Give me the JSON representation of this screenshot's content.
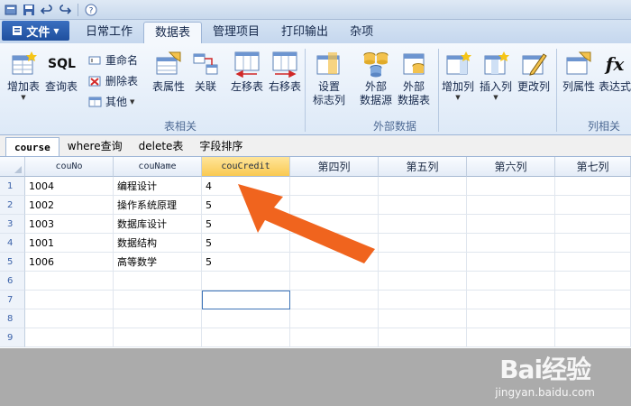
{
  "quick_access": {
    "icons": [
      "app-icon",
      "save-icon",
      "undo-icon",
      "redo-icon",
      "help-icon"
    ]
  },
  "menu": {
    "file_label": "文件",
    "tabs": [
      "日常工作",
      "数据表",
      "管理项目",
      "打印输出",
      "杂项"
    ]
  },
  "ribbon": {
    "add_table": "增加表",
    "query_table": "查询表",
    "rename": "重命名",
    "delete_table": "删除表",
    "other": "其他",
    "table_props": "表属性",
    "relation": "关联",
    "shift_left": "左移表",
    "shift_right": "右移表",
    "set_flag_col_1": "设置",
    "set_flag_col_2": "标志列",
    "ext_source_1": "外部",
    "ext_source_2": "数据源",
    "ext_table_1": "外部",
    "ext_table_2": "数据表",
    "add_col": "增加列",
    "insert_col": "插入列",
    "change_col": "更改列",
    "col_props": "列属性",
    "expression": "表达式",
    "sql_label": "SQL",
    "fx_label": "fx",
    "group_table": "表相关",
    "group_external": "外部数据",
    "group_column": "列相关"
  },
  "doc_tabs": [
    "course",
    "where查询",
    "delete表",
    "字段排序"
  ],
  "grid": {
    "columns": [
      "couNo",
      "couName",
      "couCredit",
      "第四列",
      "第五列",
      "第六列",
      "第七列"
    ],
    "row_numbers": [
      "1",
      "2",
      "3",
      "4",
      "5",
      "6",
      "7",
      "8",
      "9"
    ],
    "rows": [
      [
        "1004",
        "编程设计",
        "4"
      ],
      [
        "1002",
        "操作系统原理",
        "5"
      ],
      [
        "1003",
        "数据库设计",
        "5"
      ],
      [
        "1001",
        "数据结构",
        "5"
      ],
      [
        "1006",
        "高等数学",
        "5"
      ]
    ]
  },
  "watermark": {
    "logo": "Bai经验",
    "url": "jingyan.baidu.com"
  },
  "colors": {
    "arrow": "#f0641e",
    "selected_header": "#f9c951",
    "file_button": "#1f4f9e"
  }
}
